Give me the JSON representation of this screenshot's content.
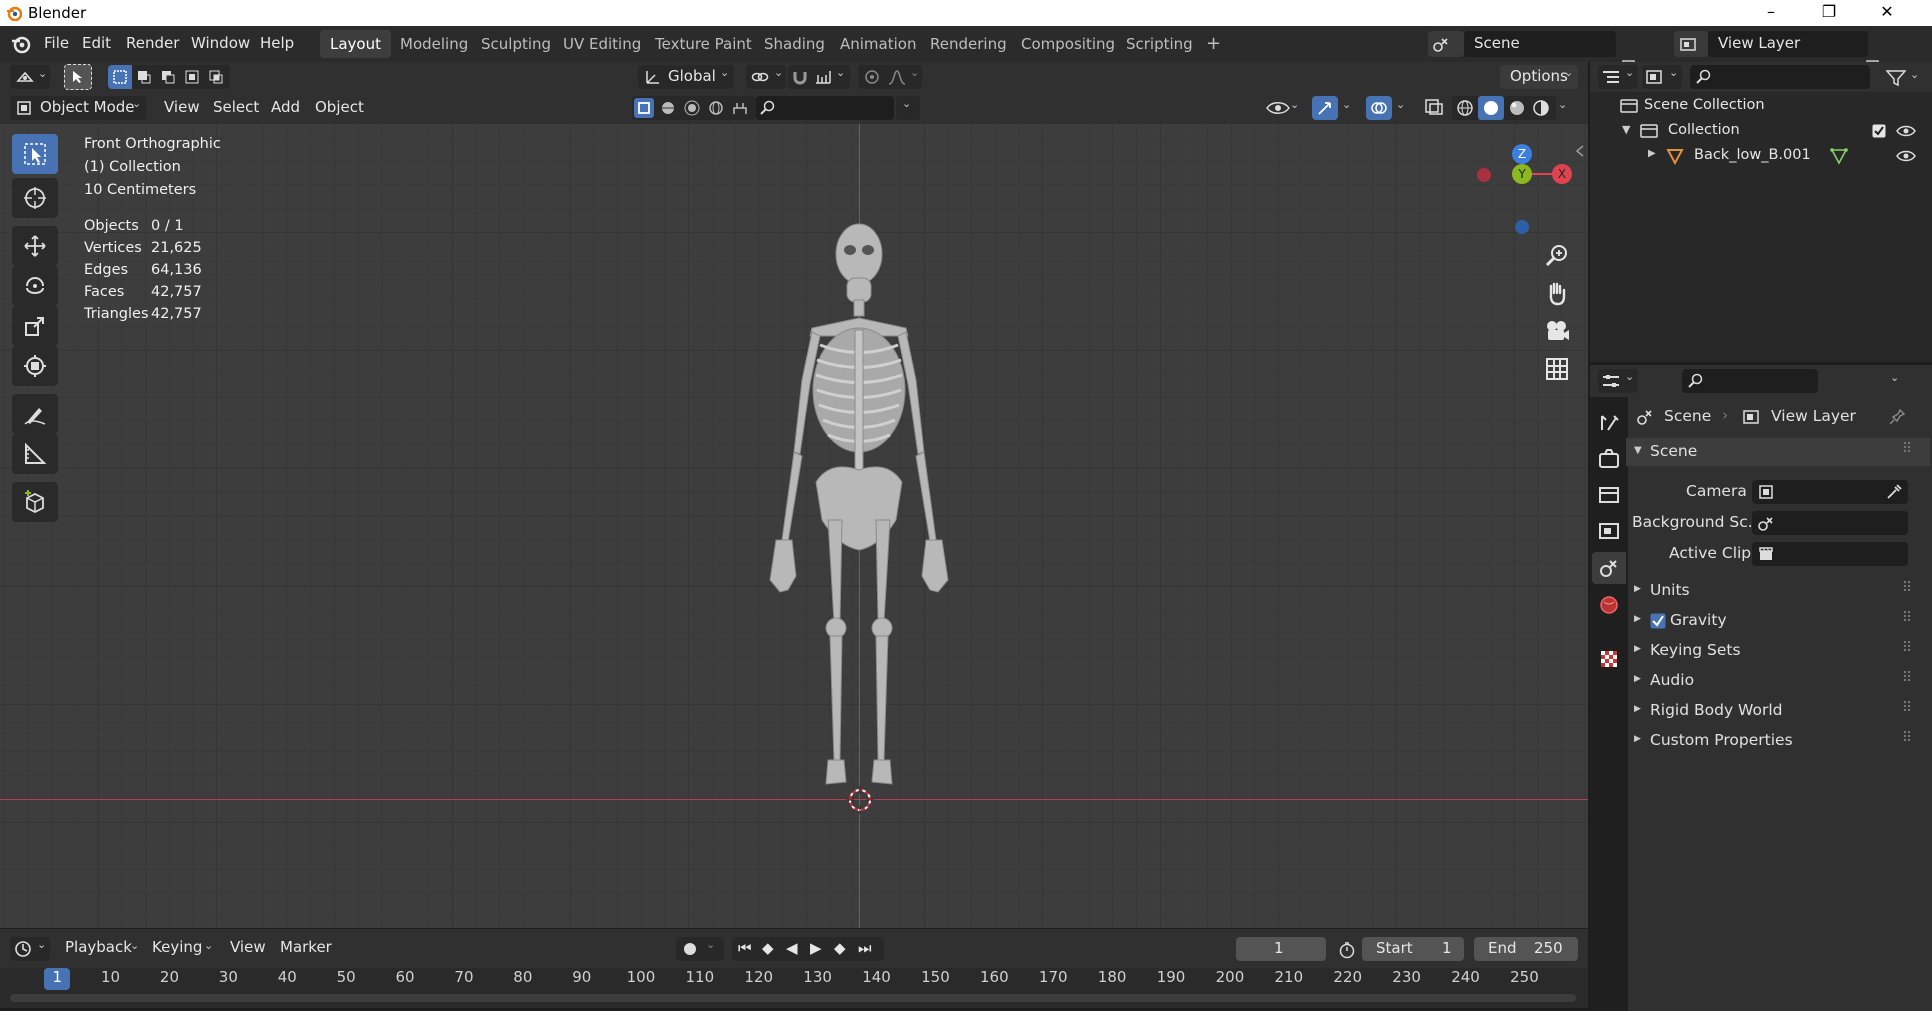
{
  "window": {
    "title": "Blender",
    "controls": [
      "–",
      "❐",
      "✕"
    ]
  },
  "menu": [
    "File",
    "Edit",
    "Render",
    "Window",
    "Help"
  ],
  "workspaces": [
    "Layout",
    "Modeling",
    "Sculpting",
    "UV Editing",
    "Texture Paint",
    "Shading",
    "Animation",
    "Rendering",
    "Compositing",
    "Scripting",
    "+"
  ],
  "scene_field": "Scene",
  "view_layer_field": "View Layer",
  "viewport": {
    "orientation": "Global",
    "options_label": "Options",
    "mode": "Object Mode",
    "header_menu": [
      "View",
      "Select",
      "Add",
      "Object"
    ],
    "overlay_text": {
      "view_name": "Front Orthographic",
      "collection": "(1) Collection",
      "scale": "10 Centimeters"
    },
    "stats": [
      {
        "label": "Objects",
        "value": "0 / 1"
      },
      {
        "label": "Vertices",
        "value": "21,625"
      },
      {
        "label": "Edges",
        "value": "64,136"
      },
      {
        "label": "Faces",
        "value": "42,757"
      },
      {
        "label": "Triangles",
        "value": "42,757"
      }
    ],
    "gizmo": {
      "z": "Z",
      "y": "Y",
      "x": "X"
    }
  },
  "timeline": {
    "menu": [
      "Playback",
      "Keying",
      "View",
      "Marker"
    ],
    "current_frame": "1",
    "start_label": "Start",
    "start_value": "1",
    "end_label": "End",
    "end_value": "250",
    "ruler": [
      "1",
      "10",
      "20",
      "30",
      "40",
      "50",
      "60",
      "70",
      "80",
      "90",
      "100",
      "110",
      "120",
      "130",
      "140",
      "150",
      "160",
      "170",
      "180",
      "190",
      "200",
      "210",
      "220",
      "230",
      "240",
      "250"
    ]
  },
  "outliner": {
    "scene_collection": "Scene Collection",
    "collection": "Collection",
    "object": "Back_low_B.001"
  },
  "properties": {
    "breadcrumb_scene": "Scene",
    "breadcrumb_view_layer": "View Layer",
    "panel_title": "Scene",
    "camera_label": "Camera",
    "background_label": "Background Sc...",
    "active_clip_label": "Active Clip",
    "subpanels": [
      "Units",
      "Gravity",
      "Keying Sets",
      "Audio",
      "Rigid Body World",
      "Custom Properties"
    ]
  },
  "colors": {
    "accent": "#4772b3",
    "x_axis": "#e0434f",
    "y_axis": "#8bb820",
    "z_axis": "#3b7fe0"
  }
}
